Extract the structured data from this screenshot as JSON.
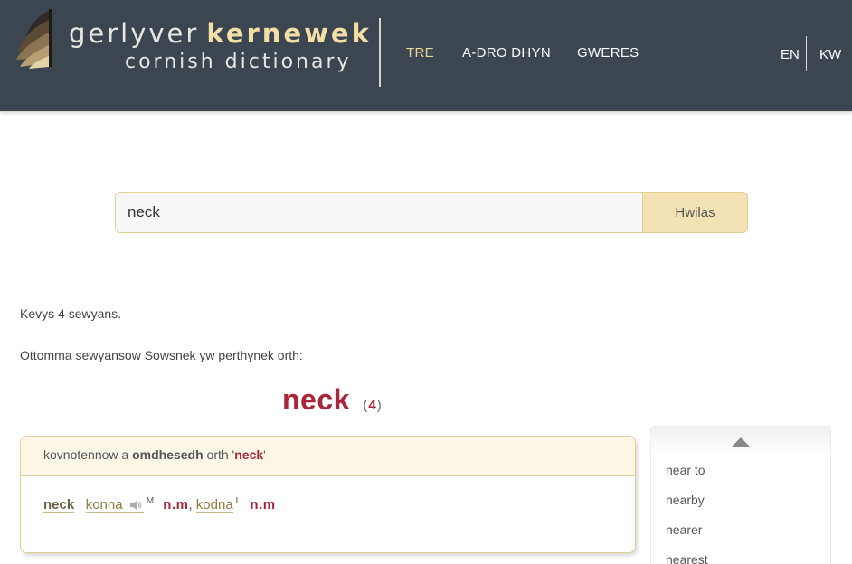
{
  "brand": {
    "line1_light": "gerlyver",
    "line1_strong": "kernewek",
    "line2": "cornish dictionary",
    "colors": {
      "header_bg": "#3b4651",
      "accent_gold": "#f2dfa6",
      "accent_red": "#a8263a"
    }
  },
  "nav": {
    "items": [
      {
        "label": "TRE",
        "active": true
      },
      {
        "label": "A-DRO DHYN",
        "active": false
      },
      {
        "label": "GWERES",
        "active": false
      }
    ]
  },
  "lang": {
    "en": "EN",
    "kw": "KW"
  },
  "search": {
    "value": "neck",
    "button_label": "Hwilas"
  },
  "results": {
    "count_text": "Kevys 4 sewyans.",
    "intro_text": "Ottomma sewyansow Sowsnek yw perthynek orth:"
  },
  "headword": {
    "word": "neck",
    "count_open": "(",
    "count": "4",
    "count_close": ")"
  },
  "card": {
    "head_prefix": "kovnotennow a",
    "head_bold": "omdhesedh",
    "head_mid": "orth '",
    "head_term": "neck",
    "head_suffix": "'",
    "entry_word": "neck",
    "translations": [
      {
        "text": "konna",
        "has_audio": true,
        "sup": "M",
        "pos": "n.m"
      },
      {
        "text": "kodna",
        "has_audio": false,
        "sup": "L",
        "pos": "n.m"
      }
    ],
    "separator": ","
  },
  "sidebar": {
    "items": [
      "near to",
      "nearby",
      "nearer",
      "nearest"
    ]
  },
  "icons": {
    "logo": "fan-logo-icon",
    "speaker": "speaker-icon",
    "scroll_up": "triangle-up-icon"
  }
}
